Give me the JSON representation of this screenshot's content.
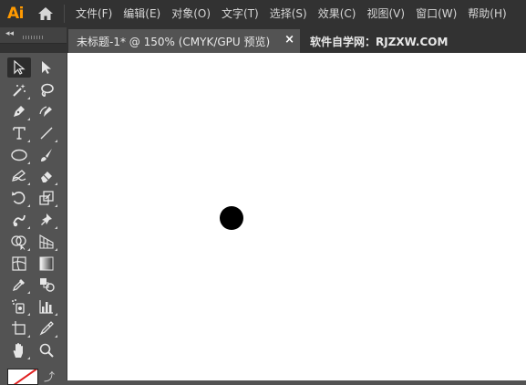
{
  "app": {
    "logo": "Ai"
  },
  "menu": [
    "文件(F)",
    "编辑(E)",
    "对象(O)",
    "文字(T)",
    "选择(S)",
    "效果(C)",
    "视图(V)",
    "窗口(W)",
    "帮助(H)"
  ],
  "tabs": {
    "active": {
      "label": "未标题-1* @ 150% (CMYK/GPU 预览)",
      "close": "×"
    },
    "inactive": {
      "label": "软件自学网：RJZXW.COM"
    }
  },
  "colors": {
    "accent": "#ff9a00",
    "fill": "#ffffff",
    "stroke_none": "#e02020"
  },
  "tools": [
    "selection-tool",
    "direct-selection-tool",
    "magic-wand-tool",
    "lasso-tool",
    "pen-tool",
    "curvature-tool",
    "type-tool",
    "line-segment-tool",
    "ellipse-tool",
    "paintbrush-tool",
    "shaper-tool",
    "eraser-tool",
    "rotate-tool",
    "scale-tool",
    "warp-tool",
    "puppet-warp-tool",
    "shape-builder-tool",
    "perspective-grid-tool",
    "mesh-tool",
    "gradient-tool",
    "eyedropper-tool",
    "blend-tool",
    "symbol-sprayer-tool",
    "column-graph-tool",
    "artboard-tool",
    "slice-tool",
    "hand-tool",
    "zoom-tool"
  ]
}
